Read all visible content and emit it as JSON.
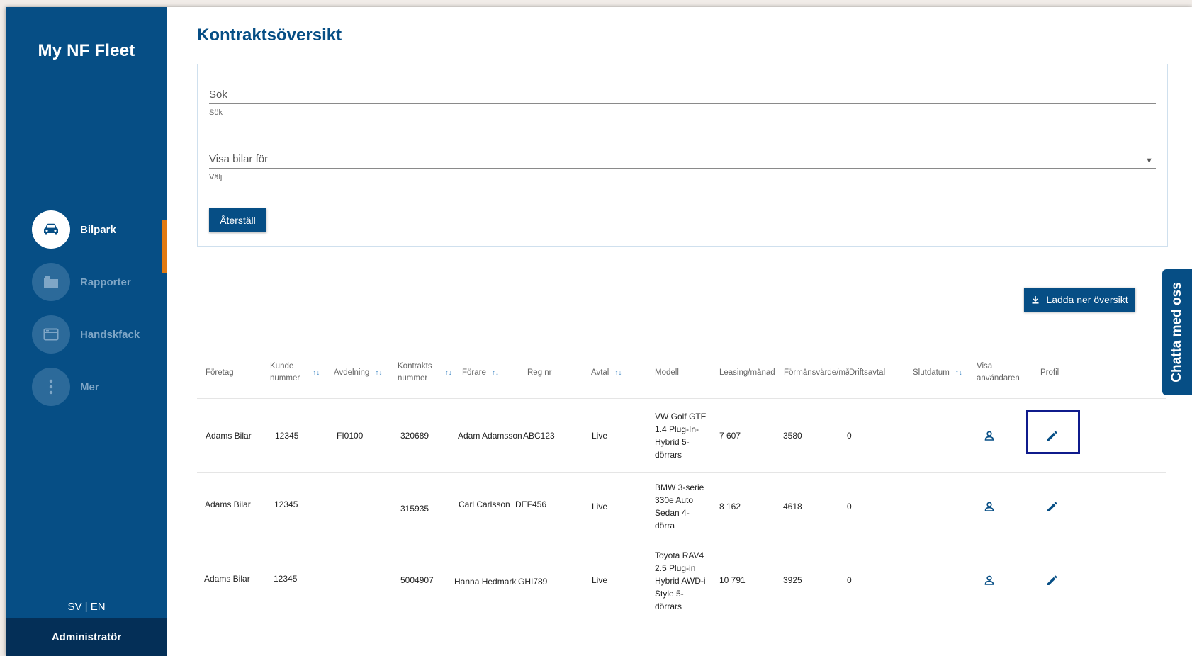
{
  "sidebar": {
    "brand": "My NF Fleet",
    "items": [
      {
        "label": "Bilpark",
        "icon": "car-icon"
      },
      {
        "label": "Rapporter",
        "icon": "folder-icon"
      },
      {
        "label": "Handskfack",
        "icon": "glovebox-icon"
      },
      {
        "label": "Mer",
        "icon": "more-vertical-icon"
      }
    ],
    "lang_sv": "SV",
    "lang_sep": " | ",
    "lang_en": "EN",
    "role": "Administratör"
  },
  "page": {
    "title": "Kontraktsöversikt"
  },
  "filters": {
    "search_placeholder": "Sök",
    "search_helper": "Sök",
    "cars_for_placeholder": "Visa bilar för",
    "cars_for_helper": "Välj",
    "reset_label": "Återställ"
  },
  "actions": {
    "download_label": "Ladda ner översikt"
  },
  "chat": {
    "label": "Chatta med oss"
  },
  "table": {
    "headers": {
      "company": "Företag",
      "customer_no_1": "Kunde",
      "customer_no_2": "nummer",
      "department": "Avdelning",
      "contract_no_1": "Kontrakts",
      "contract_no_2": "nummer",
      "driver": "Förare",
      "reg_no": "Reg nr",
      "agreement": "Avtal",
      "model": "Modell",
      "leasing": "Leasing/månad",
      "benefit": "Förmånsvärde/må",
      "operating": "Driftsavtal",
      "end_date": "Slutdatum",
      "show_user_1": "Visa",
      "show_user_2": "användaren",
      "profile": "Profil"
    },
    "rows": [
      {
        "company": "Adams Bilar",
        "customer_no": "12345",
        "department": "FI0100",
        "contract_no": "320689",
        "driver": "Adam Adamsson",
        "reg_no": "ABC123",
        "agreement": "Live",
        "model": [
          "VW Golf GTE",
          "1.4 Plug-In-",
          "Hybrid 5-",
          "dörrars"
        ],
        "leasing": "7 607",
        "benefit": "3580",
        "operating": "0"
      },
      {
        "company": "Adams Bilar",
        "customer_no": "12345",
        "department": "",
        "contract_no": "315935",
        "driver": "Carl Carlsson",
        "reg_no": "DEF456",
        "agreement": "Live",
        "model": [
          "BMW 3-serie",
          "330e Auto",
          "Sedan 4-",
          "dörra"
        ],
        "leasing": "8 162",
        "benefit": "4618",
        "operating": "0"
      },
      {
        "company": "Adams Bilar",
        "customer_no": "12345",
        "department": "",
        "contract_no": "5004907",
        "driver": "Hanna Hedmark",
        "reg_no": "GHI789",
        "agreement": "Live",
        "model": [
          "Toyota RAV4",
          "2.5 Plug-in",
          "Hybrid AWD-i",
          "Style 5-",
          "dörrars"
        ],
        "leasing": "10 791",
        "benefit": "3925",
        "operating": "0"
      }
    ]
  },
  "colors": {
    "primary": "#064e85",
    "accent": "#e07a12",
    "highlight": "#0f1b8c"
  }
}
